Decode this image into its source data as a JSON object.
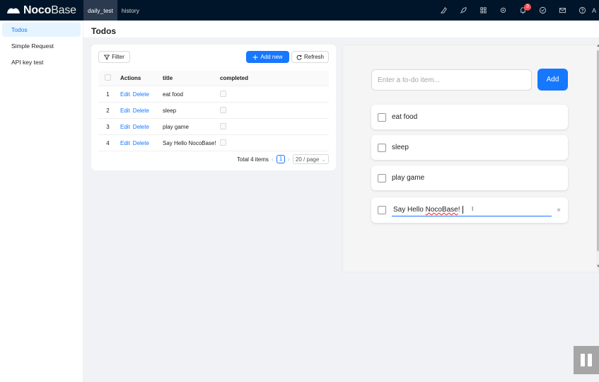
{
  "app": {
    "logo_bold": "Noco",
    "logo_light": "Base",
    "tabs": [
      "daily_test",
      "history"
    ],
    "notification_count": "3",
    "avatar_initial": "A",
    "top_icons": [
      "highlighter-icon",
      "rocket-icon",
      "grid-icon",
      "settings-icon",
      "bell-icon",
      "check-circle-icon",
      "mail-icon",
      "help-icon"
    ]
  },
  "sidebar": {
    "items": [
      {
        "label": "Todos",
        "active": true
      },
      {
        "label": "Simple Request",
        "active": false
      },
      {
        "label": "API key test",
        "active": false
      }
    ]
  },
  "page": {
    "title": "Todos"
  },
  "table_block": {
    "filter_label": "Filter",
    "add_new_label": "Add new",
    "refresh_label": "Refresh",
    "columns": [
      "Actions",
      "title",
      "completed"
    ],
    "edit_label": "Edit",
    "delete_label": "Delete",
    "rows": [
      {
        "index": "1",
        "title": "eat food"
      },
      {
        "index": "2",
        "title": "sleep"
      },
      {
        "index": "3",
        "title": "play game"
      },
      {
        "index": "4",
        "title": "Say Hello NocoBase!"
      }
    ],
    "total_text": "Total 4 items",
    "current_page": "1",
    "page_size": "20 / page"
  },
  "todo_panel": {
    "input_placeholder": "Enter a to-do item...",
    "add_label": "Add",
    "items": [
      "eat food",
      "sleep",
      "play game"
    ],
    "editing_prefix": "Say Hello ",
    "editing_word": "NocoBase",
    "editing_suffix": "!",
    "clear_glyph": "×",
    "cursor_glyph": "I"
  },
  "colors": {
    "primary": "#1677ff",
    "header_bg": "#001529",
    "badge": "#ff4d4f"
  }
}
